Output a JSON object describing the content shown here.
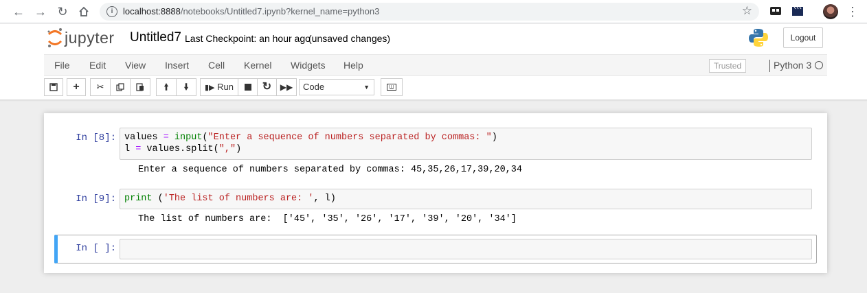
{
  "browser": {
    "url_host": "localhost:8888",
    "url_path": "/notebooks/Untitled7.ipynb?kernel_name=python3"
  },
  "header": {
    "logo_text": "jupyter",
    "notebook_name": "Untitled7",
    "checkpoint": "Last Checkpoint: an hour ago",
    "unsaved": "(unsaved changes)",
    "logout_label": "Logout"
  },
  "menu": {
    "items": [
      "File",
      "Edit",
      "View",
      "Insert",
      "Cell",
      "Kernel",
      "Widgets",
      "Help"
    ],
    "trusted": "Trusted",
    "kernel": "Python 3"
  },
  "toolbar": {
    "run_label": "Run",
    "cell_type": "Code"
  },
  "cells": [
    {
      "prompt": "In [8]:",
      "code_line1_a": "values",
      "code_line1_b": " = ",
      "code_line1_c": "input",
      "code_line1_d": "(",
      "code_line1_e": "\"Enter a sequence of numbers separated by commas: \"",
      "code_line1_f": ")",
      "code_line2_a": "l",
      "code_line2_b": " = ",
      "code_line2_c": "values.split(",
      "code_line2_d": "\",\"",
      "code_line2_e": ")",
      "output": "Enter a sequence of numbers separated by commas: 45,35,26,17,39,20,34"
    },
    {
      "prompt": "In [9]:",
      "code_a": "print",
      "code_b": " (",
      "code_c": "'The list of numbers are: '",
      "code_d": ", l)",
      "output": "The list of numbers are:  ['45', '35', '26', '17', '39', '20', '34']"
    },
    {
      "prompt": "In [ ]:"
    }
  ]
}
